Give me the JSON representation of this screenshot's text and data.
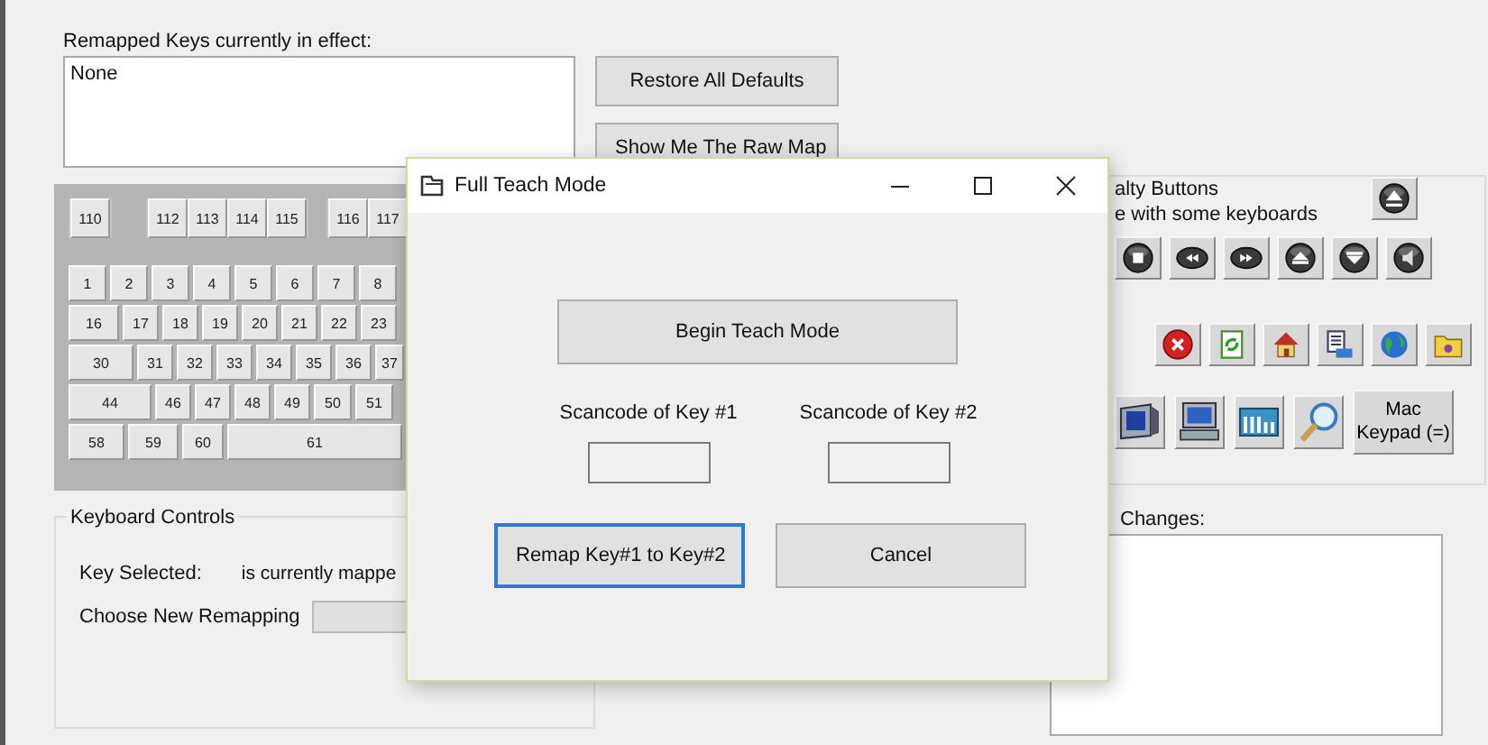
{
  "remapped": {
    "label": "Remapped Keys currently in effect:",
    "items": [
      "None"
    ]
  },
  "buttons": [
    "Restore All Defaults",
    "Show Me The Raw Map"
  ],
  "keyboard": {
    "top_groups": [
      [
        "110"
      ],
      [
        "112",
        "113",
        "114",
        "115"
      ],
      [
        "116",
        "117"
      ]
    ],
    "key_rows": [
      {
        "keys": [
          {
            "label": "1"
          },
          {
            "label": "2"
          },
          {
            "label": "3"
          },
          {
            "label": "4"
          },
          {
            "label": "5"
          },
          {
            "label": "6"
          },
          {
            "label": "7"
          },
          {
            "label": "8"
          }
        ]
      },
      {
        "keys": [
          {
            "label": "16"
          },
          {
            "label": "17"
          },
          {
            "label": "18"
          },
          {
            "label": "19"
          },
          {
            "label": "20"
          },
          {
            "label": "21"
          },
          {
            "label": "22"
          },
          {
            "label": "23"
          }
        ]
      },
      {
        "keys": [
          {
            "label": "30"
          },
          {
            "label": "31"
          },
          {
            "label": "32"
          },
          {
            "label": "33"
          },
          {
            "label": "34"
          },
          {
            "label": "35"
          },
          {
            "label": "36"
          },
          {
            "label": "37"
          }
        ]
      },
      {
        "keys": [
          {
            "label": "44"
          },
          {
            "label": "46"
          },
          {
            "label": "47"
          },
          {
            "label": "48"
          },
          {
            "label": "49"
          },
          {
            "label": "50"
          },
          {
            "label": "51"
          }
        ]
      },
      {
        "keys": [
          {
            "label": "58"
          },
          {
            "label": "59"
          },
          {
            "label": "60"
          },
          {
            "label": "61"
          }
        ]
      }
    ]
  },
  "keyboard_controls": {
    "title": "Keyboard Controls",
    "key_selected": "Key Selected:",
    "mapped": "is currently mappe",
    "choose": "Choose New Remapping",
    "dropdown_disabled": true
  },
  "specialty": {
    "title": "alty Buttons",
    "note": "e with some keyboards",
    "top": [
      {
        "kind": "eject"
      }
    ],
    "rows": [
      [
        {
          "kind": "stop"
        },
        {
          "kind": "rewind"
        },
        {
          "kind": "fast-forward"
        },
        {
          "kind": "up-triangle"
        },
        {
          "kind": "down-triangle"
        },
        {
          "kind": "speaker"
        }
      ],
      [
        {
          "kind": "close"
        },
        {
          "kind": "refresh"
        },
        {
          "kind": "home"
        },
        {
          "kind": "document"
        },
        {
          "kind": "globe"
        },
        {
          "kind": "folder"
        }
      ],
      [
        {
          "kind": "monitor"
        },
        {
          "kind": "computer"
        },
        {
          "kind": "keyboard"
        },
        {
          "kind": "search"
        },
        {
          "kind": "text",
          "label": "Mac Keypad (=)"
        }
      ]
    ]
  },
  "changes": {
    "label": "Changes:"
  },
  "dialog": {
    "title": "Full Teach Mode",
    "begin": "Begin Teach Mode",
    "field1_label": "Scancode of Key #1",
    "field2_label": "Scancode of Key #2",
    "remap": {
      "label": "Remap Key#1 to Key#2",
      "focused": true
    },
    "cancel": {
      "label": "Cancel",
      "focused": false
    }
  }
}
